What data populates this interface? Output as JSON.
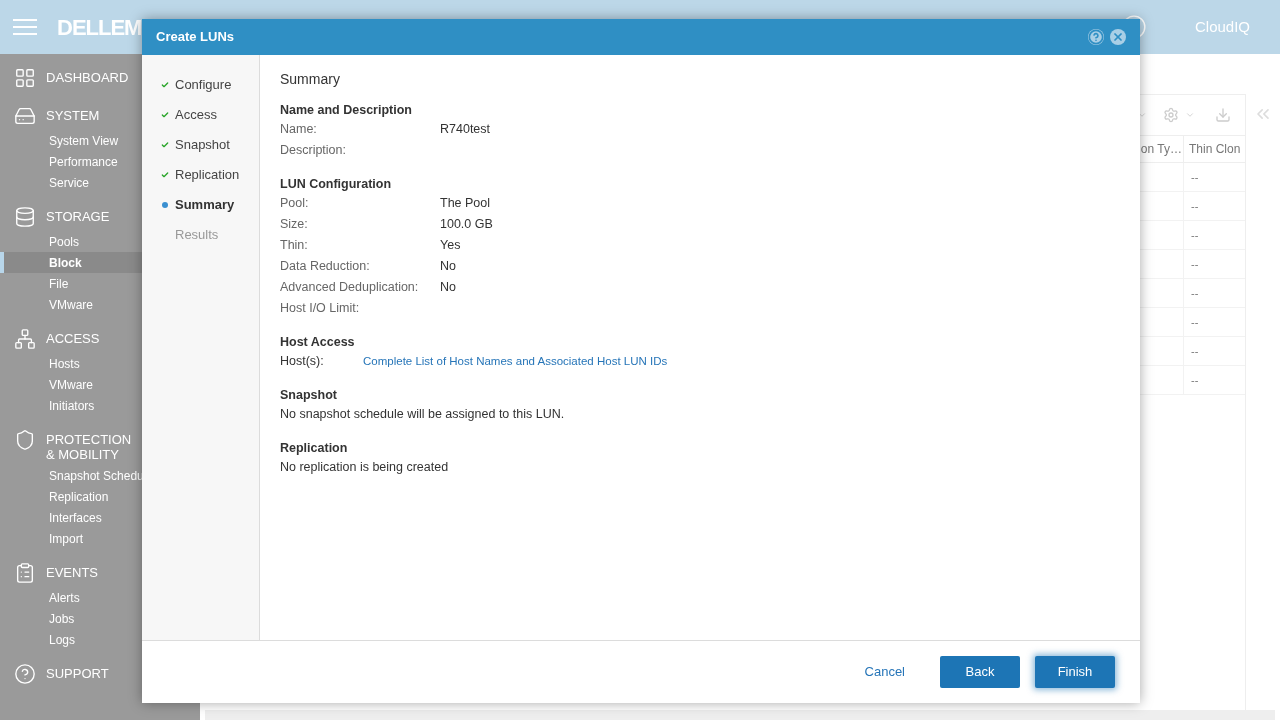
{
  "app": {
    "logo": "DELLEM",
    "cloud_logo": "CloudIQ"
  },
  "sidebar": {
    "sections": [
      {
        "title": "DASHBOARD"
      },
      {
        "title": "SYSTEM",
        "items": [
          {
            "label": "System View",
            "selected": false
          },
          {
            "label": "Performance",
            "selected": false
          },
          {
            "label": "Service",
            "selected": false
          }
        ]
      },
      {
        "title": "STORAGE",
        "items": [
          {
            "label": "Pools",
            "selected": false
          },
          {
            "label": "Block",
            "selected": true
          },
          {
            "label": "File",
            "selected": false
          },
          {
            "label": "VMware",
            "selected": false
          }
        ]
      },
      {
        "title": "ACCESS",
        "items": [
          {
            "label": "Hosts",
            "selected": false
          },
          {
            "label": "VMware",
            "selected": false
          },
          {
            "label": "Initiators",
            "selected": false
          }
        ]
      },
      {
        "title": "PROTECTION & MOBILITY",
        "items": [
          {
            "label": "Snapshot Schedu",
            "selected": false
          },
          {
            "label": "Replication",
            "selected": false
          },
          {
            "label": "Interfaces",
            "selected": false
          },
          {
            "label": "Import",
            "selected": false
          }
        ]
      },
      {
        "title": "EVENTS",
        "items": [
          {
            "label": "Alerts",
            "selected": false
          },
          {
            "label": "Jobs",
            "selected": false
          },
          {
            "label": "Logs",
            "selected": false
          }
        ]
      },
      {
        "title": "SUPPORT"
      }
    ]
  },
  "table": {
    "columns": [
      "on Ty…",
      "Thin Clon"
    ],
    "rows": [
      [
        "--"
      ],
      [
        "--"
      ],
      [
        "--"
      ],
      [
        "--"
      ],
      [
        "--"
      ],
      [
        "--"
      ],
      [
        "--"
      ],
      [
        "--"
      ]
    ]
  },
  "dialog": {
    "title": "Create LUNs",
    "steps": [
      {
        "label": "Configure",
        "done": true,
        "selected": false
      },
      {
        "label": "Access",
        "done": true,
        "selected": false
      },
      {
        "label": "Snapshot",
        "done": true,
        "selected": false
      },
      {
        "label": "Replication",
        "done": true,
        "selected": false
      },
      {
        "label": "Summary",
        "done": false,
        "selected": true
      },
      {
        "label": "Results",
        "done": false,
        "selected": false
      }
    ],
    "heading": "Summary",
    "sections": [
      {
        "title": "Name and Description",
        "kind": "fields",
        "fields": [
          {
            "label": "Name:",
            "value": "R740test"
          },
          {
            "label": "Description:"
          }
        ]
      },
      {
        "title": "LUN Configuration",
        "kind": "fields",
        "fields": [
          {
            "label": "Pool:",
            "value": "The Pool"
          },
          {
            "label": "Size:",
            "value": "100.0 GB"
          },
          {
            "label": "Thin:",
            "value": "Yes"
          },
          {
            "label": "Data Reduction:",
            "value": "No"
          },
          {
            "label": "Advanced Deduplication:",
            "value": "No"
          },
          {
            "label": "Host I/O Limit:"
          }
        ]
      },
      {
        "title": "Host Access",
        "kind": "link",
        "label": "Host(s):",
        "link": "Complete List of Host Names and Associated Host LUN IDs"
      },
      {
        "title": "Snapshot",
        "kind": "text",
        "text": "No snapshot schedule will be assigned to this LUN."
      },
      {
        "title": "Replication",
        "kind": "text",
        "text": "No replication is being created"
      }
    ],
    "buttons": {
      "cancel": "Cancel",
      "back": "Back",
      "finish": "Finish"
    }
  }
}
